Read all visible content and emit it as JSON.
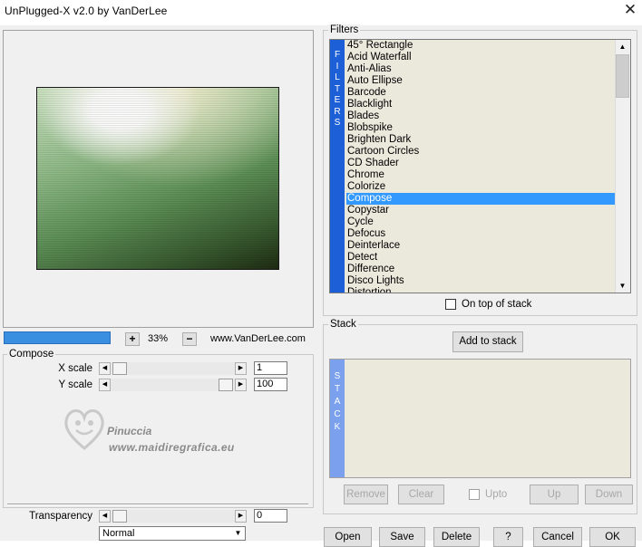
{
  "window": {
    "title": "UnPlugged-X v2.0 by VanDerLee",
    "close_glyph": "✕"
  },
  "preview": {
    "zoom": "33%",
    "zoom_plus": "+",
    "zoom_minus": "−",
    "website": "www.VanDerLee.com",
    "progress": 1.0
  },
  "compose": {
    "group_title": "Compose",
    "params": [
      {
        "label": "X scale",
        "value": "1"
      },
      {
        "label": "Y scale",
        "value": "100"
      }
    ],
    "transparency_label": "Transparency",
    "transparency_value": "0",
    "blend_mode": "Normal"
  },
  "watermark": {
    "line1": "Pinuccia",
    "line2": "www.maidiregrafica.eu"
  },
  "filters": {
    "group_title": "Filters",
    "strip_letters": [
      "F",
      "I",
      "L",
      "T",
      "E",
      "R",
      "S"
    ],
    "items": [
      "45° Rectangle",
      "Acid Waterfall",
      "Anti-Alias",
      "Auto Ellipse",
      "Barcode",
      "Blacklight",
      "Blades",
      "Blobspike",
      "Brighten Dark",
      "Cartoon Circles",
      "CD Shader",
      "Chrome",
      "Colorize",
      "Compose",
      "Copystar",
      "Cycle",
      "Defocus",
      "Deinterlace",
      "Detect",
      "Difference",
      "Disco Lights",
      "Distortion"
    ],
    "selected": "Compose",
    "on_top_label": "On top of stack"
  },
  "stack": {
    "group_title": "Stack",
    "add_button": "Add to stack",
    "strip_letters": [
      "S",
      "T",
      "A",
      "C",
      "K"
    ],
    "remove": "Remove",
    "clear": "Clear",
    "upto": "Upto",
    "up": "Up",
    "down": "Down"
  },
  "footer": {
    "open": "Open",
    "save": "Save",
    "delete": "Delete",
    "help": "?",
    "cancel": "Cancel",
    "ok": "OK"
  },
  "colors": {
    "accent": "#3399ff",
    "strip": "#1d5fd6",
    "panel": "#f0f0f0",
    "list_bg": "#ebe8dc"
  },
  "icons": {
    "close": "close-icon",
    "arrow_left": "arrow-left-icon",
    "arrow_right": "arrow-right-icon",
    "arrow_up": "arrow-up-icon",
    "arrow_down": "arrow-down-icon"
  }
}
